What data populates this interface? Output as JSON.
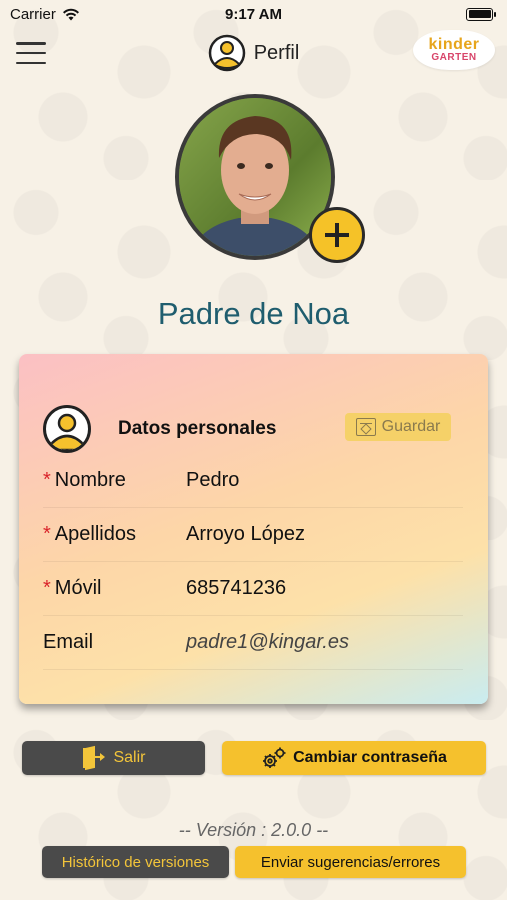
{
  "status_bar": {
    "carrier": "Carrier",
    "time": "9:17 AM",
    "battery_level": 1.0
  },
  "nav": {
    "title": "Perfil",
    "menu_icon": "hamburger-menu-icon",
    "user_icon": "user-circle-icon",
    "logo_top": "kinder",
    "logo_bottom": "GARTEN"
  },
  "profile": {
    "name": "Padre de Noa",
    "add_photo_icon": "plus-icon"
  },
  "personal_data": {
    "title": "Datos personales",
    "save_label": "Guardar",
    "fields": [
      {
        "label": "Nombre",
        "value": "Pedro",
        "required": true
      },
      {
        "label": "Apellidos",
        "value": "Arroyo López",
        "required": true
      },
      {
        "label": "Móvil",
        "value": "685741236",
        "required": true
      },
      {
        "label": "Email",
        "value": "padre1@kingar.es",
        "required": false
      }
    ],
    "required_marker": "*"
  },
  "actions": {
    "logout_label": "Salir",
    "change_password_label": "Cambiar contraseña"
  },
  "footer": {
    "version_text": "-- Versión : 2.0.0 --",
    "history_label": "Histórico de versiones",
    "feedback_label": "Enviar sugerencias/errores"
  },
  "colors": {
    "accent_yellow": "#f5c12d",
    "dark_button": "#4a4a4a",
    "title_teal": "#1f5d6e",
    "required_red": "#d9232a"
  }
}
